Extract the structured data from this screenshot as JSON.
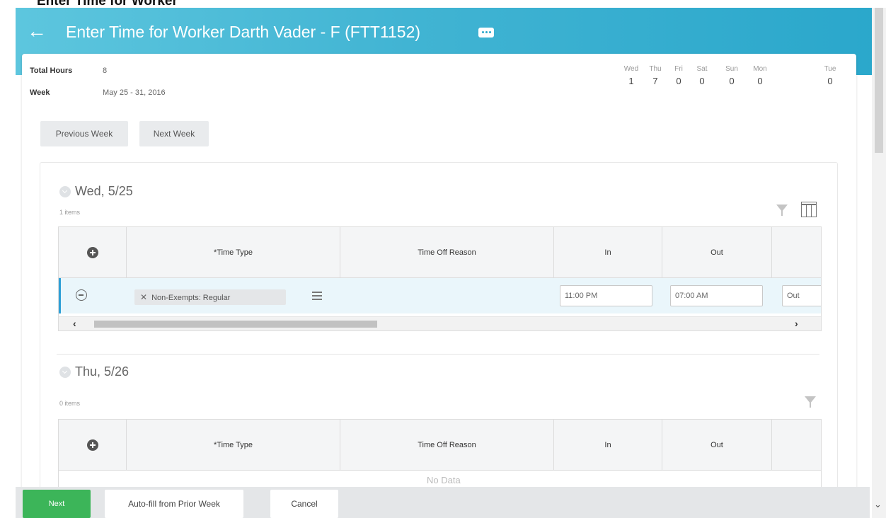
{
  "page": {
    "caption": "Enter Time for Worker"
  },
  "header": {
    "title": "Enter Time for Worker  Darth Vader - F (FTT1152)",
    "accent": "#41b4d3"
  },
  "summary": {
    "total_hours_label": "Total Hours",
    "total_hours_value": "8",
    "week_label": "Week",
    "week_value": "May 25 - 31, 2016"
  },
  "days": [
    {
      "name": "Wed",
      "hours": "1"
    },
    {
      "name": "Thu",
      "hours": "7"
    },
    {
      "name": "Fri",
      "hours": "0"
    },
    {
      "name": "Sat",
      "hours": "0"
    },
    {
      "name": "Sun",
      "hours": "0"
    },
    {
      "name": "Mon",
      "hours": "0"
    },
    {
      "name": "Tue",
      "hours": "0"
    }
  ],
  "nav": {
    "previous_week": "Previous Week",
    "next_week": "Next Week"
  },
  "columns": {
    "time_type": "*Time Type",
    "time_off_reason": "Time Off Reason",
    "in": "In",
    "out": "Out"
  },
  "sections": [
    {
      "title": "Wed, 5/25",
      "count": "1 items",
      "rows": [
        {
          "time_type": "Non-Exempts: Regular",
          "in": "11:00 PM",
          "out": "07:00 AM",
          "out_reason": "Out"
        }
      ]
    },
    {
      "title": "Thu, 5/26",
      "count": "0 items",
      "no_data": "No Data"
    }
  ],
  "footer": {
    "next": "Next",
    "autofill": "Auto-fill from Prior Week",
    "cancel": "Cancel",
    "next_color": "#3cb559"
  },
  "icons": [
    "back-arrow-icon",
    "related-actions-icon",
    "filter-icon",
    "columns-icon",
    "add-icon",
    "remove-icon",
    "prompt-list-icon",
    "collapse-icon"
  ]
}
